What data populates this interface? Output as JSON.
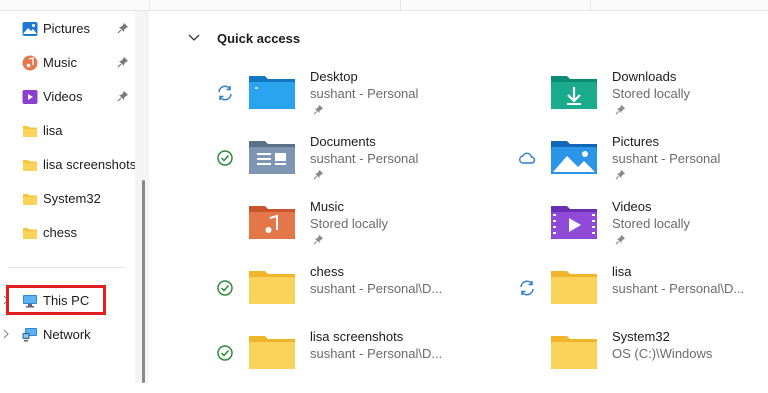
{
  "sidebar": {
    "pinned": [
      {
        "label": "Pictures",
        "icon": "pictures-icon"
      },
      {
        "label": "Music",
        "icon": "music-icon"
      },
      {
        "label": "Videos",
        "icon": "videos-icon"
      }
    ],
    "folders": [
      {
        "label": "lisa",
        "icon": "folder-icon"
      },
      {
        "label": "lisa screenshots",
        "icon": "folder-icon"
      },
      {
        "label": "System32",
        "icon": "folder-icon"
      },
      {
        "label": "chess",
        "icon": "folder-icon"
      }
    ],
    "this_pc": {
      "label": "This PC",
      "icon": "computer-icon"
    },
    "network": {
      "label": "Network",
      "icon": "network-icon"
    }
  },
  "quick_access": {
    "title": "Quick access",
    "items": [
      {
        "name": "Desktop",
        "sub": "sushant - Personal",
        "status": "sync-icon",
        "pinned": true
      },
      {
        "name": "Downloads",
        "sub": "Stored locally",
        "status": "",
        "pinned": true
      },
      {
        "name": "Documents",
        "sub": "sushant - Personal",
        "status": "check-icon",
        "pinned": true
      },
      {
        "name": "Pictures",
        "sub": "sushant - Personal",
        "status": "cloud-icon",
        "pinned": true
      },
      {
        "name": "Music",
        "sub": "Stored locally",
        "status": "",
        "pinned": true
      },
      {
        "name": "Videos",
        "sub": "Stored locally",
        "status": "",
        "pinned": true
      },
      {
        "name": "chess",
        "sub": "sushant - Personal\\D...",
        "status": "check-icon",
        "pinned": false
      },
      {
        "name": "lisa",
        "sub": "sushant - Personal\\D...",
        "status": "sync-icon",
        "pinned": false
      },
      {
        "name": "lisa screenshots",
        "sub": "sushant - Personal\\D...",
        "status": "check-icon",
        "pinned": false
      },
      {
        "name": "System32",
        "sub": "OS (C:)\\Windows",
        "status": "",
        "pinned": false
      }
    ]
  },
  "colors": {
    "highlight": "#e0201f",
    "sync": "#2b7cd3",
    "check": "#2e8b3a",
    "folder": "#f8c33d"
  }
}
